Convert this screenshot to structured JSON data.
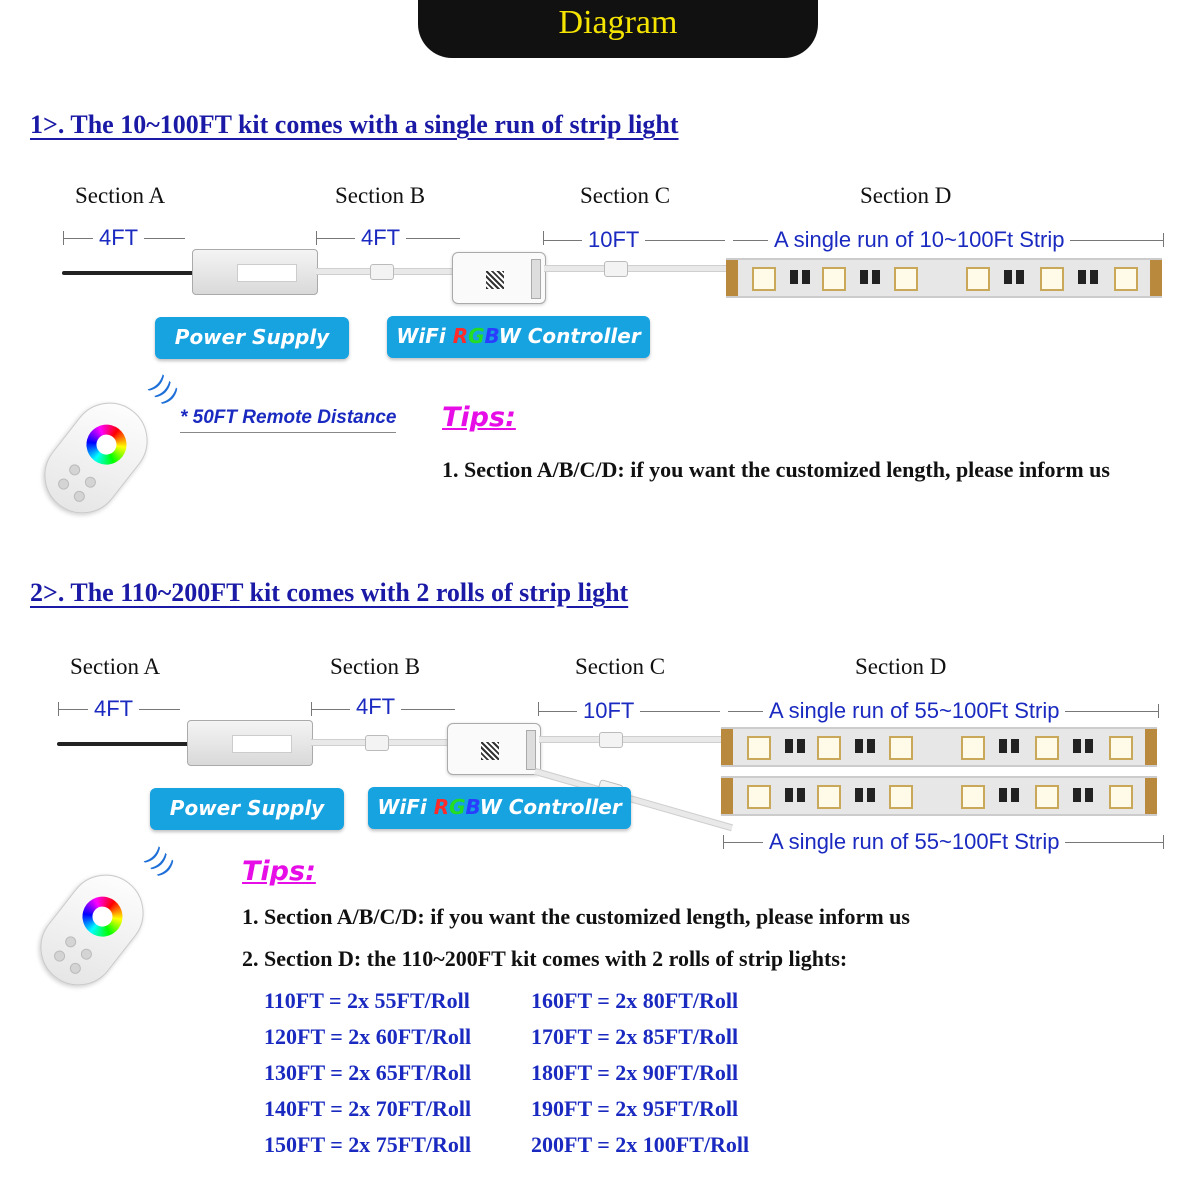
{
  "header": {
    "title": "Diagram"
  },
  "section1": {
    "heading": "1>.  The 10~100FT kit comes with a single run of strip light",
    "labels": [
      "Section A",
      "Section B",
      "Section C",
      "Section D"
    ],
    "dims": [
      "4FT",
      "4FT",
      "10FT",
      "A single run of 10~100Ft Strip"
    ],
    "power_supply_label": "Power Supply",
    "controller_label": {
      "prefix": "WiFi ",
      "r": "R",
      "g": "G",
      "b": "B",
      "suffix": "W Controller"
    },
    "remote_distance": "* 50FT Remote Distance",
    "tips_title": "Tips:",
    "tips": [
      "1. Section A/B/C/D: if you want the customized length, please inform us"
    ]
  },
  "section2": {
    "heading": "2>.  The 110~200FT kit comes with 2 rolls of strip light",
    "labels": [
      "Section A",
      "Section B",
      "Section C",
      "Section D"
    ],
    "dims": [
      "4FT",
      "4FT",
      "10FT",
      "A single run of 55~100Ft Strip"
    ],
    "strip2_dim": "A single run of 55~100Ft Strip",
    "power_supply_label": "Power Supply",
    "controller_label": {
      "prefix": "WiFi ",
      "r": "R",
      "g": "G",
      "b": "B",
      "suffix": "W Controller"
    },
    "tips_title": "Tips:",
    "tips": [
      "1. Section A/B/C/D: if you want the customized length, please inform us",
      "2. Section D: the 110~200FT kit comes with 2 rolls of strip lights:"
    ],
    "combos_left": [
      "110FT = 2x 55FT/Roll",
      "120FT = 2x 60FT/Roll",
      "130FT = 2x 65FT/Roll",
      "140FT = 2x 70FT/Roll",
      "150FT = 2x 75FT/Roll"
    ],
    "combos_right": [
      "160FT = 2x 80FT/Roll",
      "170FT = 2x 85FT/Roll",
      "180FT = 2x 90FT/Roll",
      "190FT = 2x 95FT/Roll",
      "200FT = 2x 100FT/Roll"
    ]
  },
  "colors": {
    "heading": "#1a1aa6",
    "dim_text": "#1a2ac0",
    "button": "#17a2e0",
    "tips": "#e60de6",
    "banner_text": "#f5e400",
    "r": "#ff2a2a",
    "g": "#22dd22",
    "b": "#2a3cff"
  },
  "icons": [
    "wifi-signal-icon",
    "remote-control-icon",
    "power-supply-icon",
    "controller-icon",
    "led-strip-icon"
  ]
}
